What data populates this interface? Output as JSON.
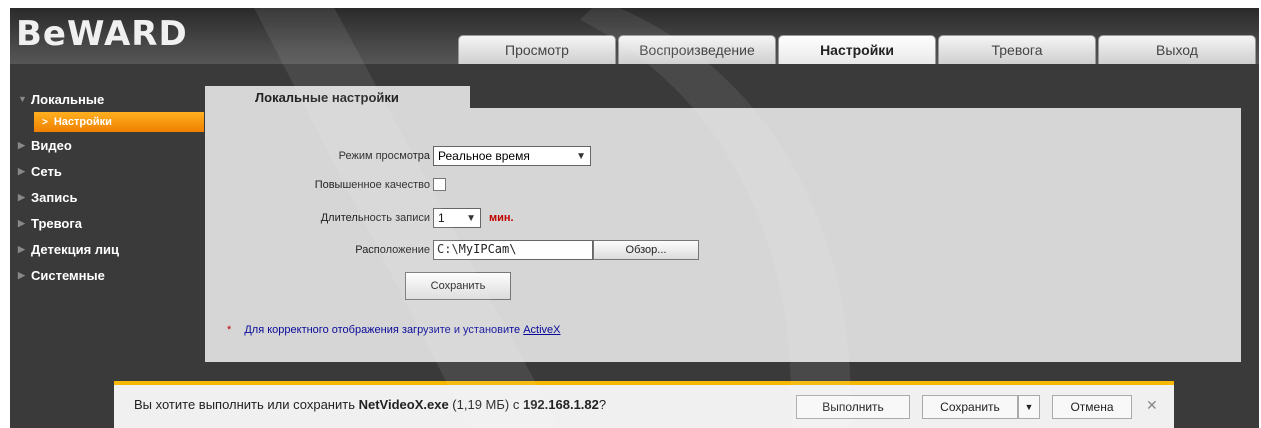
{
  "header": {
    "logo": "BeWARD"
  },
  "tabs": [
    {
      "label": "Просмотр",
      "active": false
    },
    {
      "label": "Воспроизведение",
      "active": false
    },
    {
      "label": "Настройки",
      "active": true
    },
    {
      "label": "Тревога",
      "active": false
    },
    {
      "label": "Выход",
      "active": false
    }
  ],
  "sidebar": {
    "items": [
      {
        "label": "Локальные",
        "expanded": true
      },
      {
        "label": "Видео"
      },
      {
        "label": "Сеть"
      },
      {
        "label": "Запись"
      },
      {
        "label": "Тревога"
      },
      {
        "label": "Детекция лиц"
      },
      {
        "label": "Системные"
      }
    ],
    "active_sub": "Настройки"
  },
  "content": {
    "tab_title": "Локальные настройки",
    "view_mode": {
      "label": "Режим просмотра",
      "value": "Реальное время"
    },
    "high_quality": {
      "label": "Повышенное качество",
      "checked": false
    },
    "record_duration": {
      "label": "Длительность записи",
      "value": "1",
      "unit": "мин."
    },
    "location": {
      "label": "Расположение",
      "value": "C:\\MyIPCam\\",
      "browse_label": "Обзор..."
    },
    "save_label": "Сохранить",
    "note": {
      "star": "*",
      "text": "Для корректного отображения загрузите и установите ",
      "link": "ActiveX"
    }
  },
  "download_bar": {
    "prefix": "Вы хотите выполнить или сохранить ",
    "filename": "NetVideoX.exe",
    "size": " (1,19 МБ) с ",
    "host": "192.168.1.82",
    "suffix": "?",
    "run_label": "Выполнить",
    "save_label": "Сохранить",
    "cancel_label": "Отмена"
  },
  "colors": {
    "accent": "#f08000",
    "bar_accent": "#f5b800",
    "unit_red": "#c00000"
  }
}
